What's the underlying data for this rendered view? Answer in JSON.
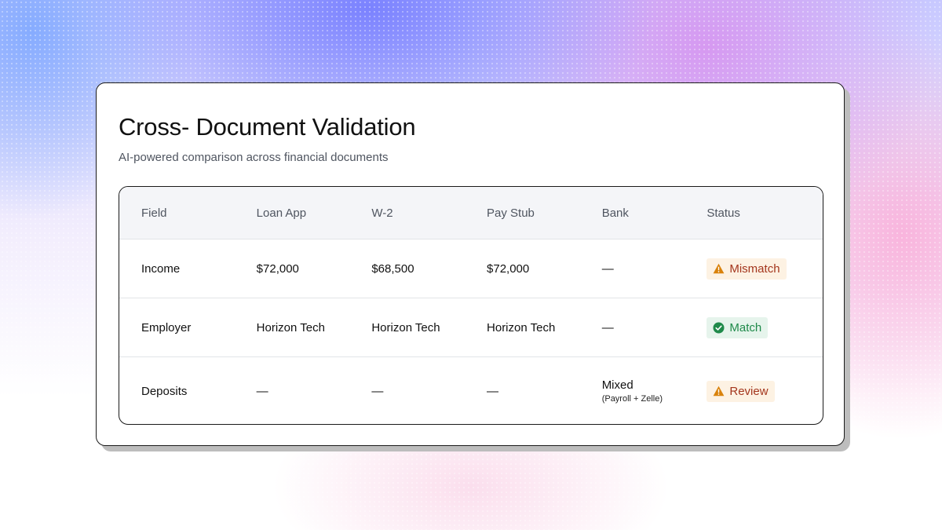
{
  "card": {
    "title": "Cross- Document Validation",
    "subtitle": "AI-powered comparison across financial documents"
  },
  "table": {
    "headers": [
      "Field",
      "Loan App",
      "W-2",
      "Pay Stub",
      "Bank",
      "Status"
    ],
    "rows": [
      {
        "field": "Income",
        "loan_app": "$72,000",
        "w2": "$68,500",
        "pay_stub": "$72,000",
        "bank": "—",
        "bank_note": "",
        "status": "Mismatch",
        "status_icon": "warning-icon"
      },
      {
        "field": "Employer",
        "loan_app": "Horizon Tech",
        "w2": "Horizon Tech",
        "pay_stub": "Horizon Tech",
        "bank": "—",
        "bank_note": "",
        "status": "Match",
        "status_icon": "check-circle-icon"
      },
      {
        "field": "Deposits",
        "loan_app": "—",
        "w2": "—",
        "pay_stub": "—",
        "bank": "Mixed",
        "bank_note": "(Payroll + Zelle)",
        "status": "Review",
        "status_icon": "warning-icon"
      }
    ]
  },
  "colors": {
    "warning_text": "#a4361d",
    "warning_bg": "#fdf2e3",
    "warning_icon": "#d9820b",
    "match_text": "#1f8a4a",
    "match_bg": "#e6f4ec"
  }
}
